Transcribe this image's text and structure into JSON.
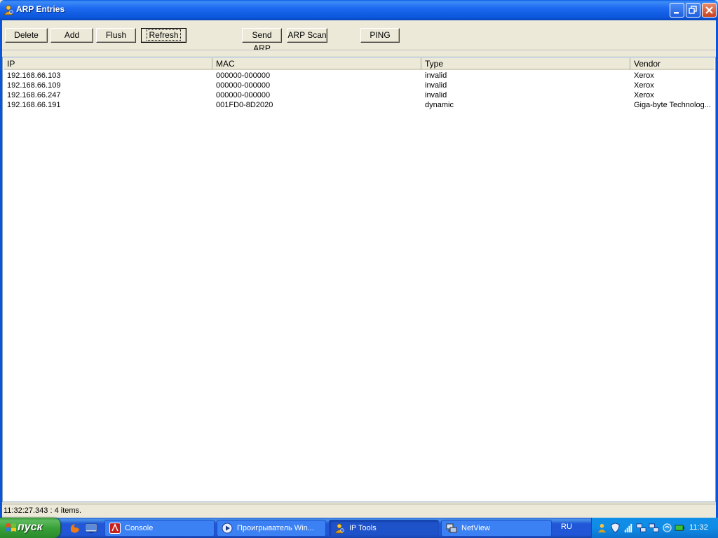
{
  "window": {
    "title": "ARP Entries"
  },
  "toolbar": {
    "buttons": [
      {
        "label": "Delete"
      },
      {
        "label": "Add"
      },
      {
        "label": "Flush"
      },
      {
        "label": "Refresh"
      },
      {
        "label": "Send ARP"
      },
      {
        "label": "ARP Scan"
      },
      {
        "label": "PING"
      }
    ]
  },
  "table": {
    "columns": [
      "IP",
      "MAC",
      "Type",
      "Vendor"
    ],
    "rows": [
      {
        "ip": "192.168.66.103",
        "mac": "000000-000000",
        "type": "invalid",
        "vendor": "Xerox"
      },
      {
        "ip": "192.168.66.109",
        "mac": "000000-000000",
        "type": "invalid",
        "vendor": "Xerox"
      },
      {
        "ip": "192.168.66.247",
        "mac": "000000-000000",
        "type": "invalid",
        "vendor": "Xerox"
      },
      {
        "ip": "192.168.66.191",
        "mac": "001FD0-8D2020",
        "type": "dynamic",
        "vendor": "Giga-byte Technolog..."
      }
    ]
  },
  "status": {
    "text": "11:32:27.343 : 4 items."
  },
  "taskbar": {
    "start_label": "пуск",
    "tasks": [
      {
        "label": "Console",
        "icon": "console-icon"
      },
      {
        "label": "Проигрыватель Win...",
        "icon": "media-player-icon"
      },
      {
        "label": "IP Tools",
        "icon": "iptools-icon"
      },
      {
        "label": "NetView",
        "icon": "netview-icon"
      }
    ],
    "language": "RU",
    "clock": "11:32"
  },
  "colors": {
    "titlebar": "#0a55d8",
    "taskbar": "#2157d7",
    "start": "#38a238",
    "tray": "#0e8ce6"
  }
}
